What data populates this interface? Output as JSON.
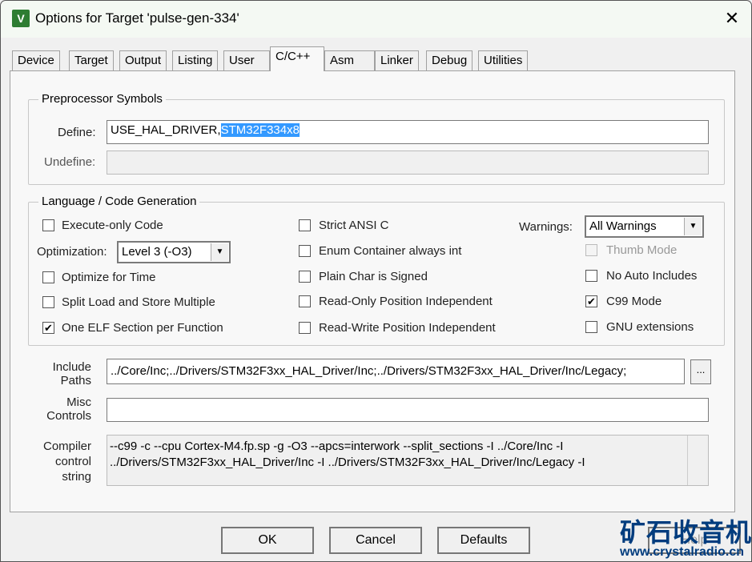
{
  "window": {
    "title": "Options for Target 'pulse-gen-334'",
    "icon": "uvision-icon",
    "close": "✕"
  },
  "tabs": [
    "Device",
    "Target",
    "Output",
    "Listing",
    "User",
    "C/C++",
    "Asm",
    "Linker",
    "Debug",
    "Utilities"
  ],
  "active_tab": "C/C++",
  "preprocessor": {
    "title": "Preprocessor Symbols",
    "define_label": "Define:",
    "define_value_plain": "USE_HAL_DRIVER,",
    "define_value_selected": "STM32F334x8",
    "undefine_label": "Undefine:",
    "undefine_value": ""
  },
  "language": {
    "title": "Language / Code Generation",
    "execute_only": {
      "label": "Execute-only Code",
      "checked": false
    },
    "optimization_label": "Optimization:",
    "optimization_value": "Level 3 (-O3)",
    "optimize_time": {
      "label": "Optimize for Time",
      "checked": false
    },
    "split_load": {
      "label": "Split Load and Store Multiple",
      "checked": false
    },
    "one_elf": {
      "label": "One ELF Section per Function",
      "checked": true
    },
    "strict_ansi": {
      "label": "Strict ANSI C",
      "checked": false
    },
    "enum_int": {
      "label": "Enum Container always int",
      "checked": false
    },
    "plain_char": {
      "label": "Plain Char is Signed",
      "checked": false
    },
    "ropi": {
      "label": "Read-Only Position Independent",
      "checked": false
    },
    "rwpi": {
      "label": "Read-Write Position Independent",
      "checked": false
    },
    "warnings_label": "Warnings:",
    "warnings_value": "All Warnings",
    "thumb_mode": {
      "label": "Thumb Mode",
      "checked": false
    },
    "no_auto_includes": {
      "label": "No Auto Includes",
      "checked": false
    },
    "c99": {
      "label": "C99 Mode",
      "checked": true
    },
    "gnu_ext": {
      "label": "GNU extensions",
      "checked": false
    }
  },
  "include": {
    "label1": "Include",
    "label2": "Paths",
    "value": "../Core/Inc;../Drivers/STM32F3xx_HAL_Driver/Inc;../Drivers/STM32F3xx_HAL_Driver/Inc/Legacy;",
    "browse": "..."
  },
  "misc": {
    "label1": "Misc",
    "label2": "Controls",
    "value": ""
  },
  "compiler": {
    "label1": "Compiler",
    "label2": "control",
    "label3": "string",
    "line1": "--c99 -c --cpu Cortex-M4.fp.sp -g -O3 --apcs=interwork --split_sections -I ../Core/Inc -I",
    "line2": "../Drivers/STM32F3xx_HAL_Driver/Inc -I ../Drivers/STM32F3xx_HAL_Driver/Inc/Legacy -I"
  },
  "buttons": {
    "ok": "OK",
    "cancel": "Cancel",
    "defaults": "Defaults",
    "help": "Help"
  },
  "watermark": {
    "text": "矿石收音机",
    "url": "www.crystalradio.cn"
  }
}
